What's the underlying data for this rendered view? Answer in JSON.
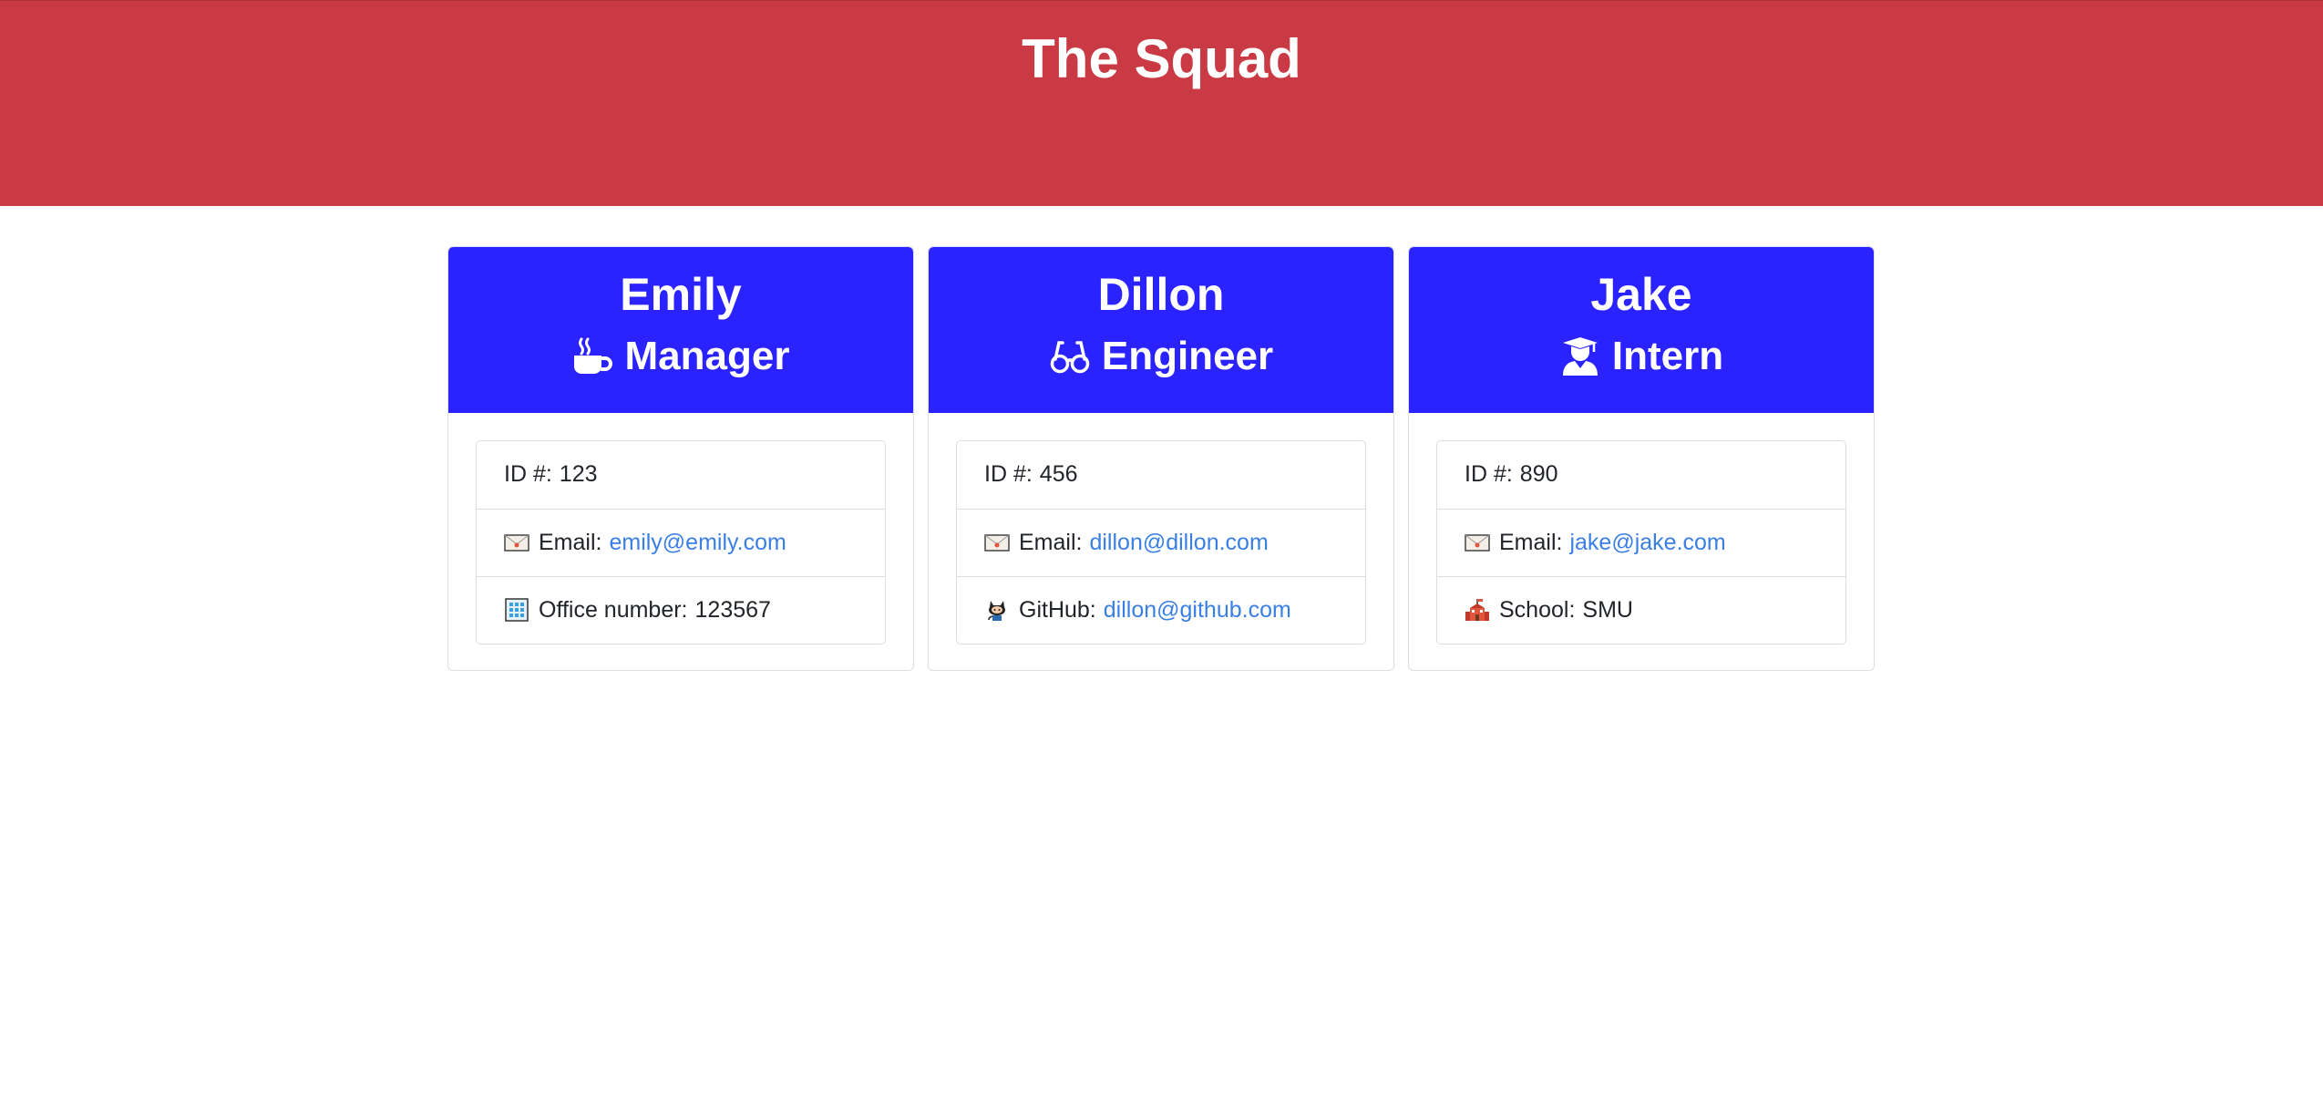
{
  "header": {
    "title": "The Squad",
    "background": "#c93a45"
  },
  "accent": "#2b23ff",
  "link_color": "#3a7fe4",
  "employees": [
    {
      "name": "Emily",
      "role": "Manager",
      "role_icon": "coffee-mug-icon",
      "id_label": "ID #:",
      "id": "123",
      "email_label": "Email:",
      "email": "emily@emily.com",
      "extra_icon": "building-icon",
      "extra_label": "Office number:",
      "extra_value": "123567"
    },
    {
      "name": "Dillon",
      "role": "Engineer",
      "role_icon": "glasses-icon",
      "id_label": "ID #:",
      "id": "456",
      "email_label": "Email:",
      "email": "dillon@dillon.com",
      "extra_icon": "github-octocat-icon",
      "extra_label": "GitHub:",
      "extra_value": "dillon@github.com"
    },
    {
      "name": "Jake",
      "role": "Intern",
      "role_icon": "graduate-icon",
      "id_label": "ID #:",
      "id": "890",
      "email_label": "Email:",
      "email": "jake@jake.com",
      "extra_icon": "school-icon",
      "extra_label": "School:",
      "extra_value": "SMU"
    }
  ]
}
